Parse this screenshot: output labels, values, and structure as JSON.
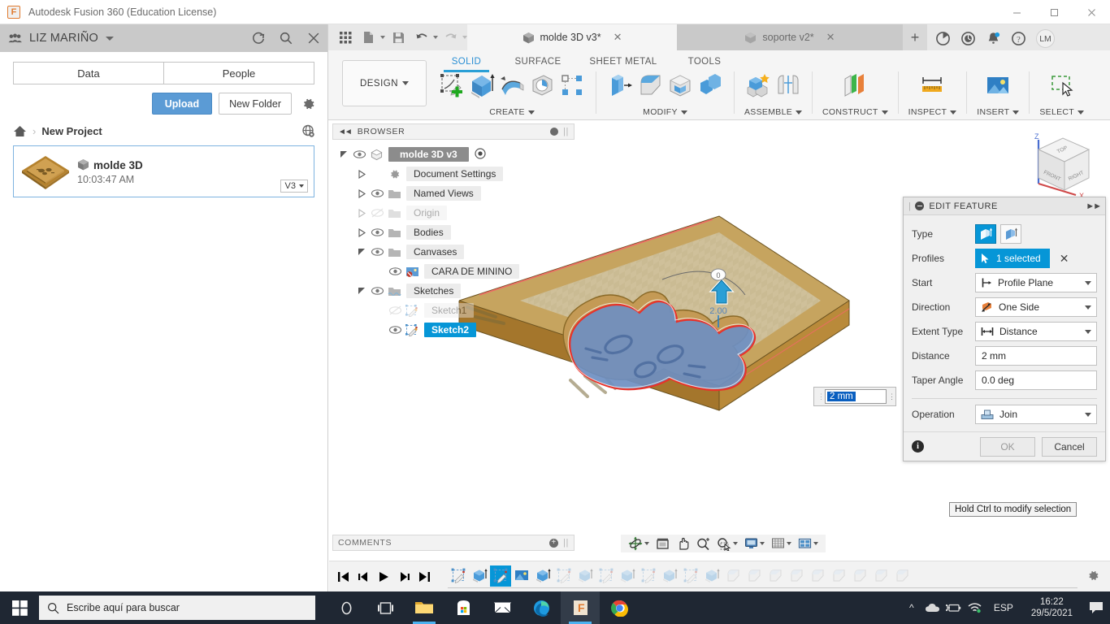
{
  "window": {
    "title": "Autodesk Fusion 360 (Education License)",
    "logo_letter": "F",
    "minimize": "—",
    "maximize": "□",
    "close": "✕"
  },
  "data_panel": {
    "user": "LIZ MARIÑO",
    "header_icons": [
      "refresh-icon",
      "search-icon",
      "close-icon"
    ],
    "tabs": [
      {
        "label": "Data"
      },
      {
        "label": "People"
      }
    ],
    "upload_label": "Upload",
    "new_folder_label": "New Folder",
    "breadcrumb": {
      "home": "home-icon",
      "separator": "›",
      "project": "New Project"
    },
    "file": {
      "name": "molde 3D",
      "time": "10:03:47 AM",
      "version": "V3"
    }
  },
  "doc_tabs": {
    "active": {
      "label": "molde 3D v3*",
      "close": "✕"
    },
    "inactive": {
      "label": "soporte v2*",
      "close": "✕"
    },
    "add": "+"
  },
  "top_right_icons": [
    "job-status-icon",
    "recent-icon",
    "notifications-icon",
    "help-icon"
  ],
  "avatar": "LM",
  "ribbon": {
    "design_label": "DESIGN",
    "tabs": [
      {
        "label": "SOLID",
        "active": true
      },
      {
        "label": "SURFACE",
        "active": false
      },
      {
        "label": "SHEET METAL",
        "active": false
      },
      {
        "label": "TOOLS",
        "active": false
      }
    ],
    "groups": [
      {
        "label": "CREATE",
        "has_caret": true,
        "icons": [
          "create-sketch-icon",
          "extrude-icon",
          "revolve-icon",
          "sweep-icon",
          "pattern-icon"
        ]
      },
      {
        "label": "MODIFY",
        "has_caret": true,
        "icons": [
          "press-pull-icon",
          "fillet-icon",
          "shell-icon",
          "combine-icon"
        ]
      },
      {
        "label": "ASSEMBLE",
        "has_caret": true,
        "icons": [
          "new-component-icon",
          "joint-icon"
        ]
      },
      {
        "label": "CONSTRUCT",
        "has_caret": true,
        "icons": [
          "offset-plane-icon"
        ]
      },
      {
        "label": "INSPECT",
        "has_caret": true,
        "icons": [
          "measure-icon"
        ]
      },
      {
        "label": "INSERT",
        "has_caret": true,
        "icons": [
          "insert-canvas-icon"
        ]
      },
      {
        "label": "SELECT",
        "has_caret": true,
        "icons": [
          "select-window-icon"
        ]
      }
    ]
  },
  "browser": {
    "title": "BROWSER",
    "nodes": [
      {
        "label": "molde 3D v3",
        "indent": 0,
        "arrow": "down",
        "eye": true,
        "icon": "component-icon",
        "style": "root"
      },
      {
        "label": "Document Settings",
        "indent": 1,
        "arrow": "right",
        "eye": false,
        "icon": "gear-icon",
        "style": "normal"
      },
      {
        "label": "Named Views",
        "indent": 1,
        "arrow": "right",
        "eye": true,
        "icon": "folder-icon",
        "style": "normal"
      },
      {
        "label": "Origin",
        "indent": 1,
        "arrow": "right",
        "eye": "hidden",
        "icon": "folder-icon",
        "style": "dim"
      },
      {
        "label": "Bodies",
        "indent": 1,
        "arrow": "right",
        "eye": true,
        "icon": "folder-icon",
        "style": "normal"
      },
      {
        "label": "Canvases",
        "indent": 1,
        "arrow": "down",
        "eye": true,
        "icon": "folder-icon",
        "style": "normal"
      },
      {
        "label": "CARA DE MININO",
        "indent": 2,
        "arrow": "none",
        "eye": true,
        "icon": "canvas-image-icon",
        "style": "normal"
      },
      {
        "label": "Sketches",
        "indent": 1,
        "arrow": "down",
        "eye": true,
        "icon": "folder-sketch-icon",
        "style": "normal"
      },
      {
        "label": "Sketch1",
        "indent": 2,
        "arrow": "none",
        "eye": "hidden",
        "icon": "sketch-icon",
        "style": "dim"
      },
      {
        "label": "Sketch2",
        "indent": 2,
        "arrow": "none",
        "eye": true,
        "icon": "sketch-icon",
        "style": "selected"
      }
    ]
  },
  "edit_feature": {
    "title": "EDIT FEATURE",
    "type_label": "Type",
    "type_options": [
      "extrude-profile-icon",
      "extrude-edge-icon"
    ],
    "type_selected_index": 0,
    "profiles_label": "Profiles",
    "profiles_value": "1 selected",
    "profiles_clear": "✕",
    "start_label": "Start",
    "start_value": "Profile Plane",
    "direction_label": "Direction",
    "direction_value": "One Side",
    "extent_type_label": "Extent Type",
    "extent_type_value": "Distance",
    "distance_label": "Distance",
    "distance_value": "2 mm",
    "taper_label": "Taper Angle",
    "taper_value": "0.0 deg",
    "operation_label": "Operation",
    "operation_value": "Join",
    "ok_label": "OK",
    "cancel_label": "Cancel"
  },
  "viewport": {
    "dimension_input_value": "2 mm",
    "tooltip": "Hold Ctrl to modify selection",
    "viewcube": {
      "top": "TOP",
      "front": "FRONT",
      "right": "RIGHT",
      "axis_z": "Z",
      "axis_x": "X"
    },
    "manipulator_label": "2.00"
  },
  "comments": {
    "title": "COMMENTS"
  },
  "navbar_icons": [
    "orbit-icon",
    "look-at-icon",
    "pan-icon",
    "zoom-icon",
    "zoom-window-icon",
    "display-settings-icon",
    "grid-snaps-icon",
    "viewports-icon"
  ],
  "timeline": {
    "play_controls": [
      "jump-start-icon",
      "step-back-icon",
      "play-icon",
      "step-forward-icon",
      "jump-end-icon"
    ],
    "features": [
      {
        "icon": "sketch-icon",
        "state": "done"
      },
      {
        "icon": "extrude-icon",
        "state": "done"
      },
      {
        "icon": "sketch-icon",
        "state": "selected"
      },
      {
        "icon": "canvas-icon",
        "state": "done"
      },
      {
        "icon": "extrude-icon",
        "state": "done"
      },
      {
        "icon": "sketch-icon",
        "state": "pending"
      },
      {
        "icon": "extrude-icon",
        "state": "pending"
      },
      {
        "icon": "sketch-icon",
        "state": "pending"
      },
      {
        "icon": "extrude-icon",
        "state": "pending"
      },
      {
        "icon": "sketch-icon",
        "state": "pending"
      },
      {
        "icon": "extrude-icon",
        "state": "pending"
      },
      {
        "icon": "sketch-icon",
        "state": "pending"
      },
      {
        "icon": "extrude-icon",
        "state": "pending"
      },
      {
        "icon": "fillet-icon",
        "state": "pending"
      },
      {
        "icon": "fillet-icon",
        "state": "pending"
      },
      {
        "icon": "fillet-icon",
        "state": "pending"
      },
      {
        "icon": "fillet-icon",
        "state": "pending"
      },
      {
        "icon": "fillet-icon",
        "state": "pending"
      },
      {
        "icon": "fillet-icon",
        "state": "pending"
      },
      {
        "icon": "fillet-icon",
        "state": "pending"
      },
      {
        "icon": "fillet-icon",
        "state": "pending"
      },
      {
        "icon": "fillet-icon",
        "state": "pending"
      }
    ],
    "settings": "gear-icon"
  },
  "taskbar": {
    "search_placeholder": "Escribe aquí para buscar",
    "icons": [
      "cortana-icon",
      "task-view-icon",
      "file-explorer-icon",
      "microsoft-store-icon",
      "mail-icon",
      "edge-icon",
      "fusion360-icon",
      "chrome-icon"
    ],
    "tray": {
      "chevron": "^",
      "icons": [
        "onedrive-icon",
        "battery-icon",
        "wifi-icon"
      ],
      "language": "ESP",
      "time": "16:22",
      "date": "29/5/2021",
      "action_center": "action-center-icon"
    }
  },
  "colors": {
    "accent_blue": "#0696d7",
    "upload_blue": "#5b9bd5",
    "mold_tan": "#c7a15a",
    "mold_dark": "#a4762c",
    "profile_blue": "#6f8fc0",
    "highlight_red": "#e8322a",
    "taskbar": "#1f2733"
  }
}
